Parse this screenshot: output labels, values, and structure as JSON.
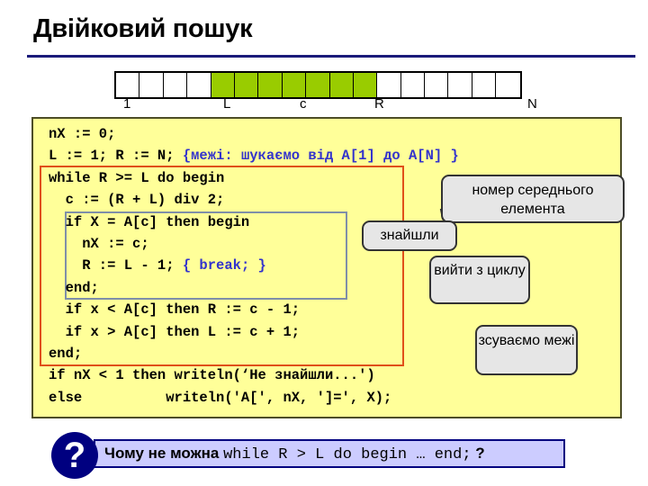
{
  "title": "Двійковий пошук",
  "array": {
    "cells": [
      false,
      false,
      false,
      false,
      true,
      true,
      true,
      true,
      true,
      true,
      true,
      false,
      false,
      false,
      false,
      false,
      false
    ],
    "highlight_color": "#99cc00",
    "labels": {
      "first": "1",
      "left": "L",
      "center": "c",
      "right": "R",
      "last": "N"
    }
  },
  "code": {
    "lines": [
      {
        "text": "nX := 0;"
      },
      {
        "text": "L := 1; R := N; ",
        "comment": "{межі: шукаємо від A[1] до A[N] }"
      },
      {
        "text": "while R >= L do begin"
      },
      {
        "text": "  c := (R + L) div 2;"
      },
      {
        "text": "  if X = A[c] then begin"
      },
      {
        "text": "    nX := c;"
      },
      {
        "text": "    R := L - 1; ",
        "comment": "{ break; }"
      },
      {
        "text": "  end;"
      },
      {
        "text": "  if x < A[c] then R := c - 1;"
      },
      {
        "text": "  if x > A[c] then L := c + 1;"
      },
      {
        "text": "end;"
      },
      {
        "text": "if nX < 1 then writeln(‘Не знайшли...')"
      },
      {
        "text": "else          writeln('A[', nX, ']=', X);"
      }
    ]
  },
  "callouts": {
    "middle": "номер середнього елемента",
    "found": "знайшли",
    "exit": "вийти з циклу",
    "shift": "зсуваємо межі"
  },
  "question": {
    "icon": "question-mark-icon",
    "prefix": "Чому не можна ",
    "code": "while R > L do begin … end;",
    "suffix": " ?"
  }
}
